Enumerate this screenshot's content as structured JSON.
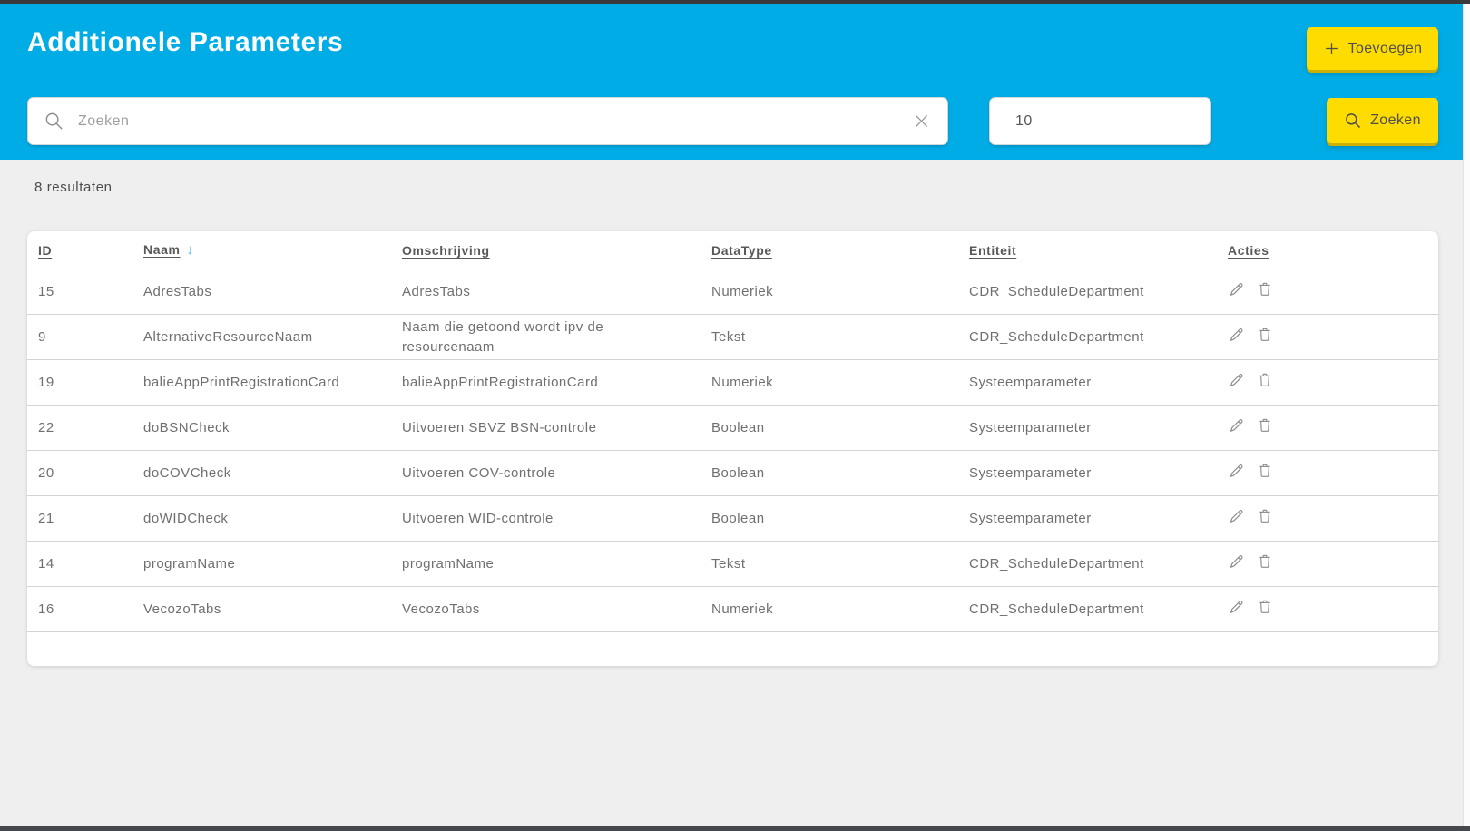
{
  "header": {
    "title": "Additionele Parameters",
    "add_button_label": "Toevoegen",
    "search_placeholder": "Zoeken",
    "page_size_value": "10",
    "search_button_label": "Zoeken"
  },
  "results_summary": "8 resultaten",
  "table": {
    "sort_indicator": "↓",
    "columns": [
      {
        "label": "ID"
      },
      {
        "label": "Naam",
        "sorted": "desc"
      },
      {
        "label": "Omschrijving"
      },
      {
        "label": "DataType"
      },
      {
        "label": "Entiteit"
      },
      {
        "label": "Acties"
      }
    ],
    "rows": [
      {
        "id": "15",
        "naam": "AdresTabs",
        "omschrijving": "AdresTabs",
        "datatype": "Numeriek",
        "entiteit": "CDR_ScheduleDepartment"
      },
      {
        "id": "9",
        "naam": "AlternativeResourceNaam",
        "omschrijving": "Naam die getoond wordt ipv de resourcenaam",
        "datatype": "Tekst",
        "entiteit": "CDR_ScheduleDepartment"
      },
      {
        "id": "19",
        "naam": "balieAppPrintRegistrationCard",
        "omschrijving": "balieAppPrintRegistrationCard",
        "datatype": "Numeriek",
        "entiteit": "Systeemparameter"
      },
      {
        "id": "22",
        "naam": "doBSNCheck",
        "omschrijving": "Uitvoeren SBVZ BSN-controle",
        "datatype": "Boolean",
        "entiteit": "Systeemparameter"
      },
      {
        "id": "20",
        "naam": "doCOVCheck",
        "omschrijving": "Uitvoeren COV-controle",
        "datatype": "Boolean",
        "entiteit": "Systeemparameter"
      },
      {
        "id": "21",
        "naam": "doWIDCheck",
        "omschrijving": "Uitvoeren WID-controle",
        "datatype": "Boolean",
        "entiteit": "Systeemparameter"
      },
      {
        "id": "14",
        "naam": "programName",
        "omschrijving": "programName",
        "datatype": "Tekst",
        "entiteit": "CDR_ScheduleDepartment"
      },
      {
        "id": "16",
        "naam": "VecozoTabs",
        "omschrijving": "VecozoTabs",
        "datatype": "Numeriek",
        "entiteit": "CDR_ScheduleDepartment"
      }
    ],
    "action_icons": [
      {
        "action": "edit",
        "name": "pencil-icon"
      },
      {
        "action": "delete",
        "name": "trash-icon"
      }
    ]
  },
  "colors": {
    "header_bg": "#00ace6",
    "accent_yellow": "#ffdc00",
    "accent_yellow_shadow": "#ccb004",
    "sort_arrow_blue": "#45b5e8",
    "page_bg": "#efefef",
    "table_text": "#6f6f6f"
  }
}
